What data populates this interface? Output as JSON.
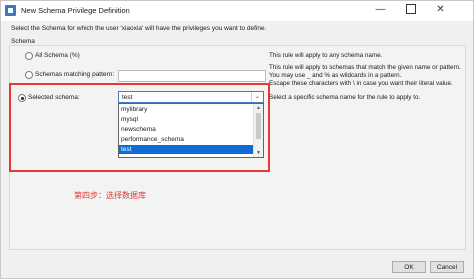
{
  "window": {
    "title": "New Schema Privilege Definition",
    "buttons": {
      "minimize": "—",
      "close": "✕"
    }
  },
  "subtitle": "Select the Schema for which the user 'xiaoxia' will have the privileges you want to define.",
  "group": {
    "label": "Schema",
    "options": [
      {
        "label": "All Schema (%)",
        "checked": false,
        "description": [
          "This rule will apply to any schema name."
        ]
      },
      {
        "label": "Schemas matching pattern:",
        "checked": false,
        "description": [
          "This rule will apply to schemas that match the given name or pattern.",
          "You may use _ and % as wildcards in a pattern.",
          "Escape these characters with \\ in case you want their literal value."
        ]
      },
      {
        "label": "Selected schema:",
        "checked": true,
        "description": [
          "Select a specific schema name for the rule to apply to."
        ]
      }
    ]
  },
  "combo": {
    "value": "test",
    "arrow": "⌄",
    "items": [
      "mylibrary",
      "mysql",
      "newschema",
      "performance_schema",
      "test"
    ],
    "selected_index": 4,
    "scroll_up": "▲",
    "scroll_down": "▼"
  },
  "annotation": "第四步：选择数据库",
  "highlight_color": "#e53935",
  "selection_color": "#0f6cd6",
  "footer": {
    "ok": "OK",
    "cancel": "Cancel"
  }
}
